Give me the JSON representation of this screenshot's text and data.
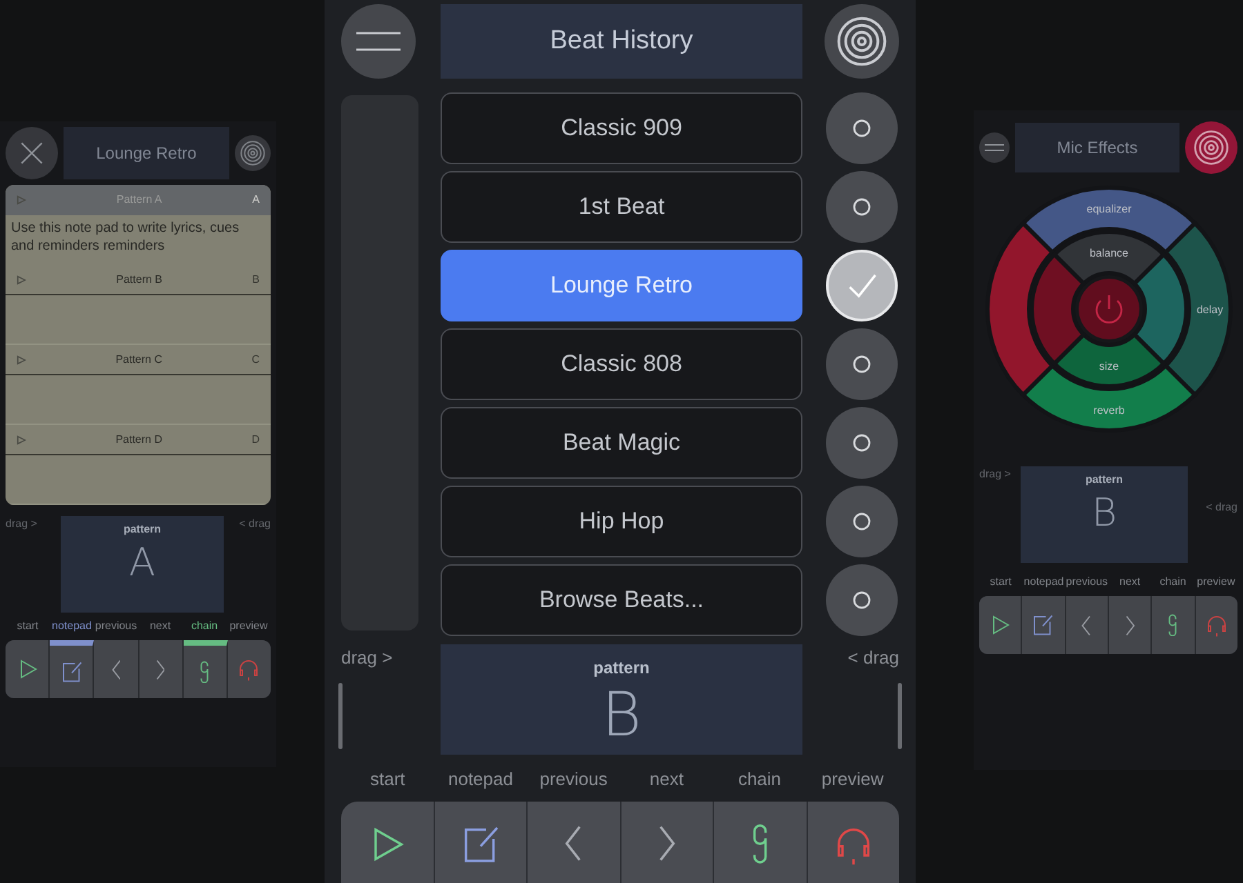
{
  "left_panel": {
    "title": "Lounge Retro",
    "notepad": {
      "text": "Use this note pad to write lyrics, cues and reminders reminders",
      "patterns": [
        {
          "name": "Pattern A",
          "letter": "A",
          "selected": true
        },
        {
          "name": "Pattern B",
          "letter": "B",
          "selected": false
        },
        {
          "name": "Pattern C",
          "letter": "C",
          "selected": false
        },
        {
          "name": "Pattern D",
          "letter": "D",
          "selected": false
        }
      ]
    },
    "drag_left": "drag >",
    "drag_right": "< drag",
    "pattern": {
      "label": "pattern",
      "value": "A"
    },
    "toolbar": [
      {
        "label": "start",
        "kind": "play",
        "active": false
      },
      {
        "label": "notepad",
        "kind": "notepad",
        "active": true
      },
      {
        "label": "previous",
        "kind": "previous",
        "active": false
      },
      {
        "label": "next",
        "kind": "next",
        "active": false
      },
      {
        "label": "chain",
        "kind": "chain",
        "active": true
      },
      {
        "label": "preview",
        "kind": "preview",
        "active": false
      }
    ]
  },
  "center": {
    "title": "Beat History",
    "beats": [
      {
        "label": "Classic 909",
        "selected": false
      },
      {
        "label": "1st Beat",
        "selected": false
      },
      {
        "label": "Lounge Retro",
        "selected": true
      },
      {
        "label": "Classic 808",
        "selected": false
      },
      {
        "label": "Beat Magic",
        "selected": false
      },
      {
        "label": "Hip Hop",
        "selected": false
      },
      {
        "label": "Browse Beats...",
        "selected": false
      }
    ],
    "drag_left": "drag >",
    "drag_right": "< drag",
    "pattern": {
      "label": "pattern",
      "value": "B"
    },
    "toolbar": [
      {
        "label": "start",
        "kind": "play",
        "active": false
      },
      {
        "label": "notepad",
        "kind": "notepad",
        "active": false
      },
      {
        "label": "previous",
        "kind": "previous",
        "active": false
      },
      {
        "label": "next",
        "kind": "next",
        "active": false
      },
      {
        "label": "chain",
        "kind": "chain",
        "active": false
      },
      {
        "label": "preview",
        "kind": "preview",
        "active": false
      }
    ]
  },
  "right_panel": {
    "title": "Mic Effects",
    "wheel": {
      "outer_ring": [
        {
          "label": "equalizer",
          "color": "#4a5f94"
        },
        {
          "label": "delay",
          "color": "#1f5c52"
        },
        {
          "label": "reverb",
          "color": "#128a52"
        },
        {
          "color": "#a0172f"
        }
      ],
      "inner_ring": [
        {
          "label": "balance",
          "color": "#35383d"
        },
        {
          "color": "#1f6e68"
        },
        {
          "label": "size",
          "color": "#0e6e42"
        },
        {
          "color": "#7a0f24"
        }
      ]
    },
    "drag_left": "drag >",
    "drag_right": "< drag",
    "pattern": {
      "label": "pattern",
      "value": "B"
    },
    "toolbar": [
      {
        "label": "start",
        "kind": "play",
        "active": false
      },
      {
        "label": "notepad",
        "kind": "notepad",
        "active": false
      },
      {
        "label": "previous",
        "kind": "previous",
        "active": false
      },
      {
        "label": "next",
        "kind": "next",
        "active": false
      },
      {
        "label": "chain",
        "kind": "chain",
        "active": false
      },
      {
        "label": "preview",
        "kind": "preview",
        "active": false
      }
    ]
  }
}
